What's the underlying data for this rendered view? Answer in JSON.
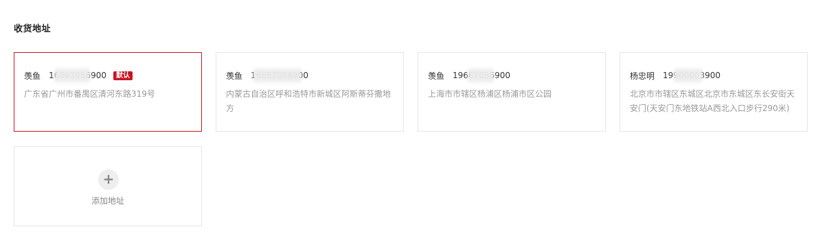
{
  "section": {
    "title": "收货地址"
  },
  "addresses": [
    {
      "name": "羡鱼",
      "phone": "16067056900",
      "default_badge": "默认",
      "address": "广东省广州市番禺区清河东路319号"
    },
    {
      "name": "羡鱼",
      "phone": "16667056900",
      "address": "内蒙古自治区呼和浩特市新城区阿斯蒂芬撒地方"
    },
    {
      "name": "羡鱼",
      "phone": "19667056900",
      "address": "上海市市辖区杨浦区杨浦市区公园"
    },
    {
      "name": "杨忠明",
      "phone": "19900003900",
      "address": "北京市市辖区东城区北京市东城区东长安街天安门(天安门东地铁站A西北入口步行290米)"
    }
  ],
  "add_button": {
    "label": "添加地址",
    "icon": "plus-icon"
  },
  "colors": {
    "accent": "#c81623",
    "border": "#e6e6e6",
    "muted_text": "#999999"
  }
}
